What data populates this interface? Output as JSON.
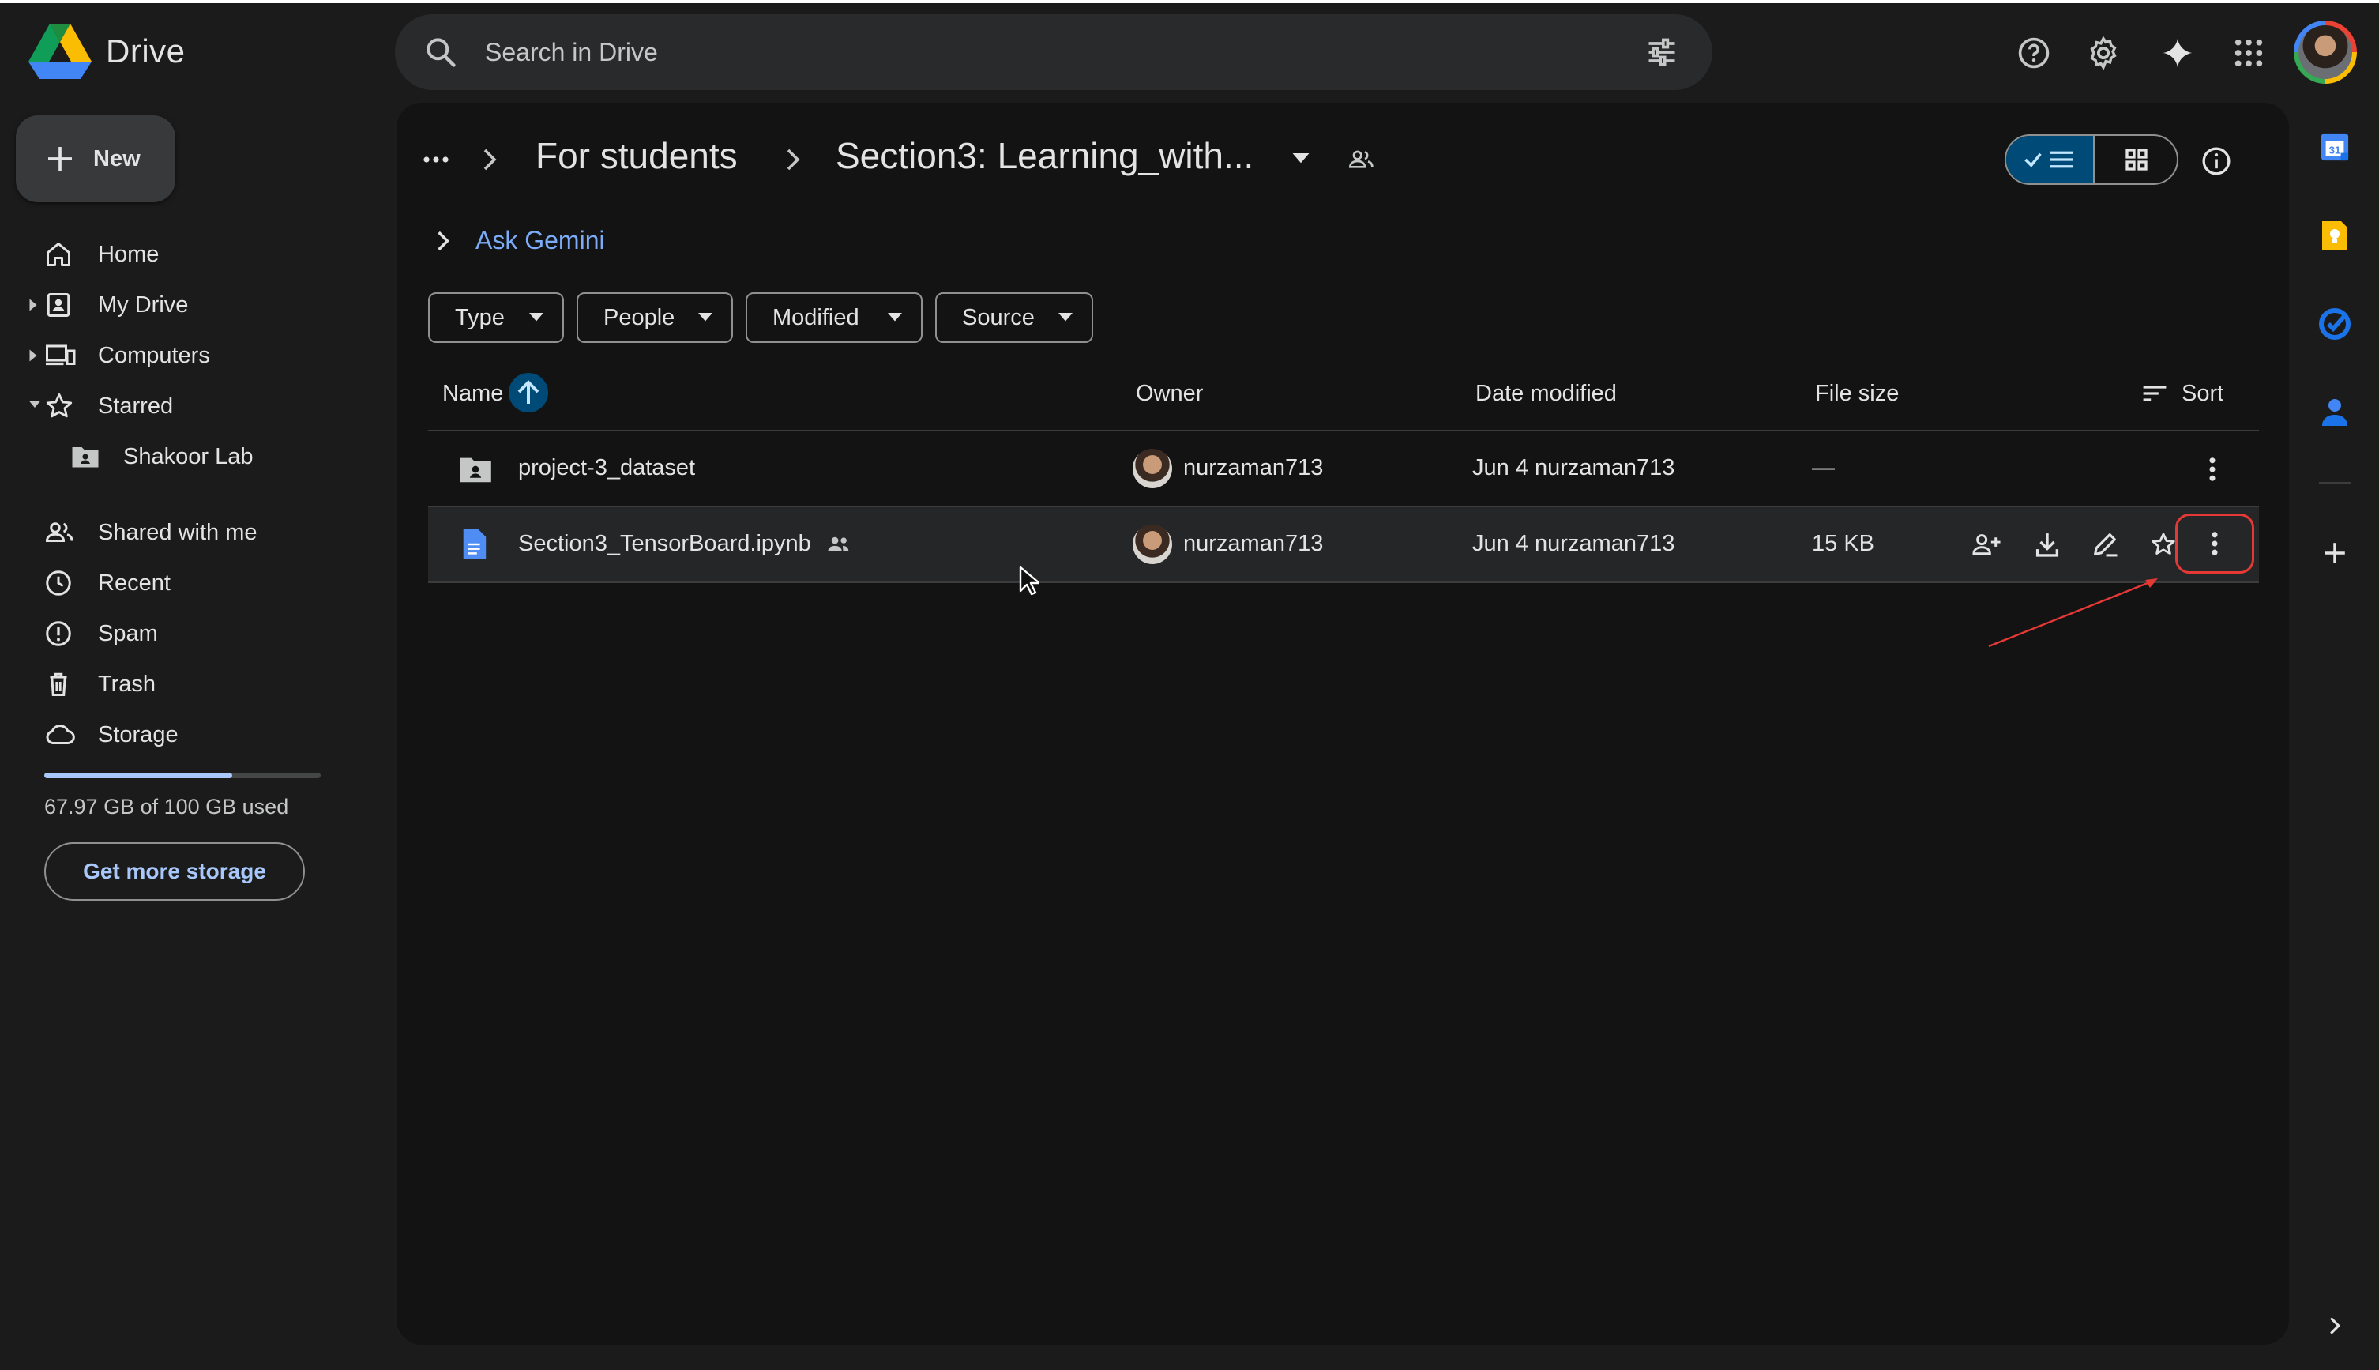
{
  "app": {
    "title": "Drive"
  },
  "header": {
    "search_placeholder": "Search in Drive"
  },
  "sidebar": {
    "new_label": "New",
    "items": [
      {
        "label": "Home",
        "icon": "home-icon"
      },
      {
        "label": "My Drive",
        "icon": "my-drive-icon",
        "expandable": true
      },
      {
        "label": "Computers",
        "icon": "computers-icon",
        "expandable": true
      },
      {
        "label": "Starred",
        "icon": "star-icon",
        "expanded": true
      },
      {
        "label": "Shakoor Lab",
        "icon": "shared-folder-icon"
      },
      {
        "label": "Shared with me",
        "icon": "people-icon"
      },
      {
        "label": "Recent",
        "icon": "clock-icon"
      },
      {
        "label": "Spam",
        "icon": "spam-icon"
      },
      {
        "label": "Trash",
        "icon": "trash-icon"
      },
      {
        "label": "Storage",
        "icon": "cloud-icon"
      }
    ],
    "storage": {
      "used_text": "67.97 GB of 100 GB used",
      "used_fraction": 0.6797
    },
    "get_more_label": "Get more storage"
  },
  "main": {
    "breadcrumb": {
      "ellipsis": "•••",
      "parent": "For students",
      "current": "Section3: Learning_with..."
    },
    "ask_gemini": "Ask Gemini",
    "filters": [
      "Type",
      "People",
      "Modified",
      "Source"
    ],
    "columns": {
      "name": "Name",
      "owner": "Owner",
      "date_modified": "Date modified",
      "file_size": "File size",
      "sort": "Sort"
    },
    "rows": [
      {
        "name": "project-3_dataset",
        "type": "shared-folder",
        "owner": "nurzaman713",
        "modified": "Jun 4 nurzaman713",
        "size": "—"
      },
      {
        "name": "Section3_TensorBoard.ipynb",
        "type": "notebook",
        "shared": true,
        "owner": "nurzaman713",
        "modified": "Jun 4 nurzaman713",
        "size": "15 KB"
      }
    ]
  },
  "colors": {
    "background": "#1b1b1b",
    "panel": "#131314",
    "accent": "#a8c7fa",
    "link": "#7cacf8",
    "highlight_outline": "#e53935"
  }
}
